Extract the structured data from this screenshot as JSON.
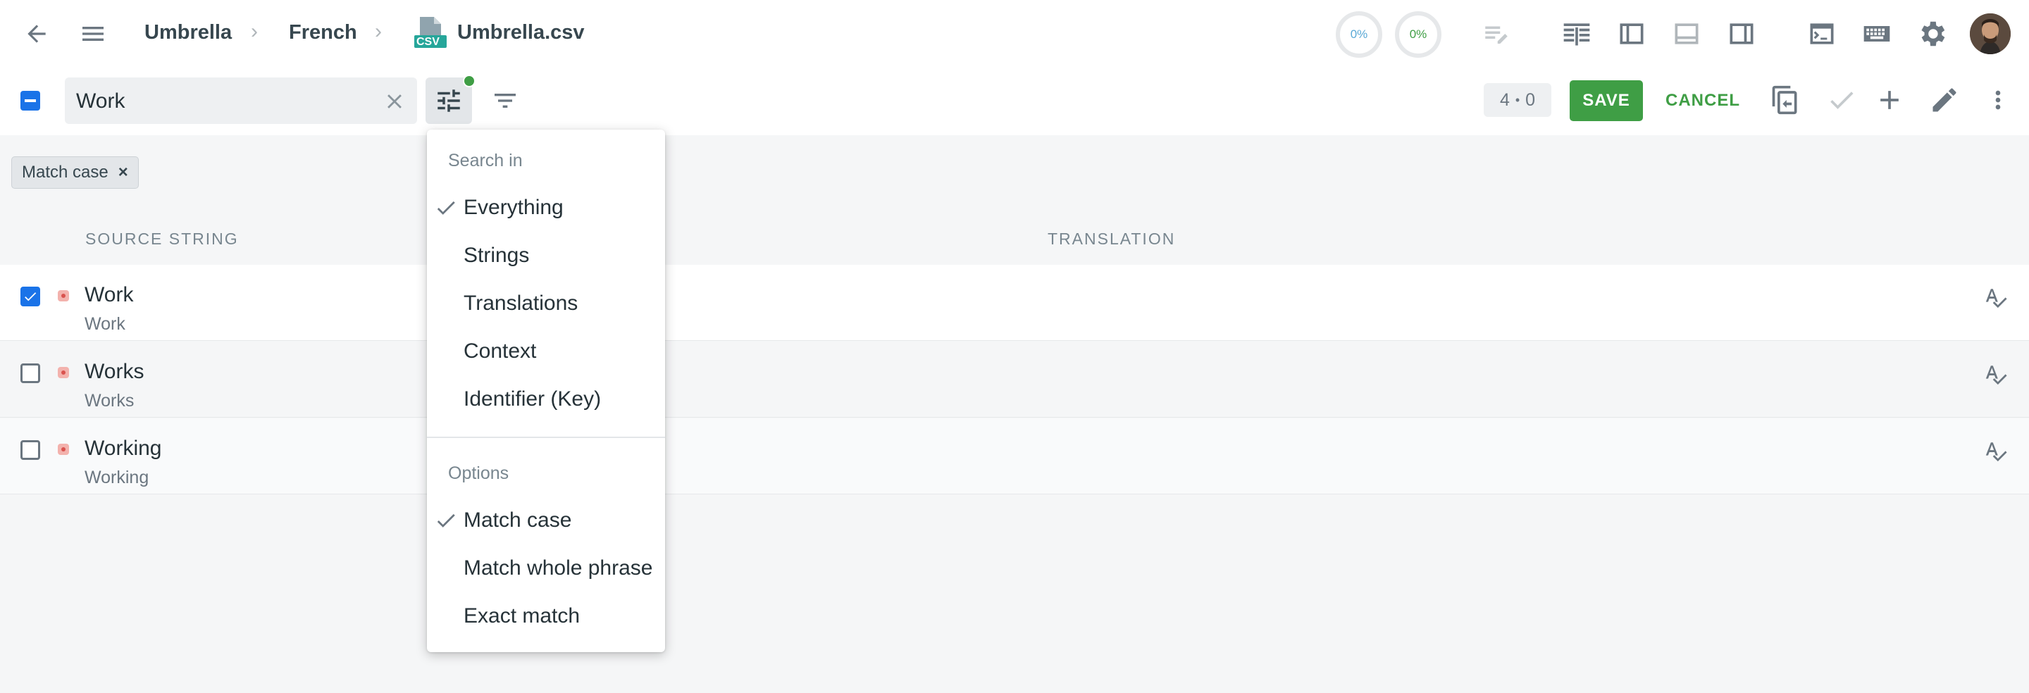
{
  "breadcrumb": {
    "project": "Umbrella",
    "language": "French",
    "file_badge": "CSV",
    "file": "Umbrella.csv"
  },
  "progress": {
    "translated": "0%",
    "approved": "0%"
  },
  "search": {
    "value": "Work"
  },
  "counter": {
    "left": "4",
    "sep": "•",
    "right": "0"
  },
  "actions": {
    "save": "SAVE",
    "cancel": "CANCEL"
  },
  "filter_chip": {
    "label": "Match case",
    "close": "×"
  },
  "columns": {
    "source": "SOURCE STRING",
    "translation": "TRANSLATION"
  },
  "rows": [
    {
      "title": "Work",
      "context": "Work",
      "checked": true
    },
    {
      "title": "Works",
      "context": "Works",
      "checked": false
    },
    {
      "title": "Working",
      "context": "Working",
      "checked": false
    }
  ],
  "dropdown": {
    "search_in_header": "Search in",
    "search_in": [
      {
        "label": "Everything",
        "checked": true
      },
      {
        "label": "Strings",
        "checked": false
      },
      {
        "label": "Translations",
        "checked": false
      },
      {
        "label": "Context",
        "checked": false
      },
      {
        "label": "Identifier (Key)",
        "checked": false
      }
    ],
    "options_header": "Options",
    "options": [
      {
        "label": "Match case",
        "checked": true
      },
      {
        "label": "Match whole phrase",
        "checked": false
      },
      {
        "label": "Exact match",
        "checked": false
      }
    ]
  },
  "colors": {
    "accent_green": "#3f9e45",
    "checkbox_blue": "#1a73e8",
    "status_red": "#d9534f",
    "filter_active_dot": "#3f9e45"
  }
}
